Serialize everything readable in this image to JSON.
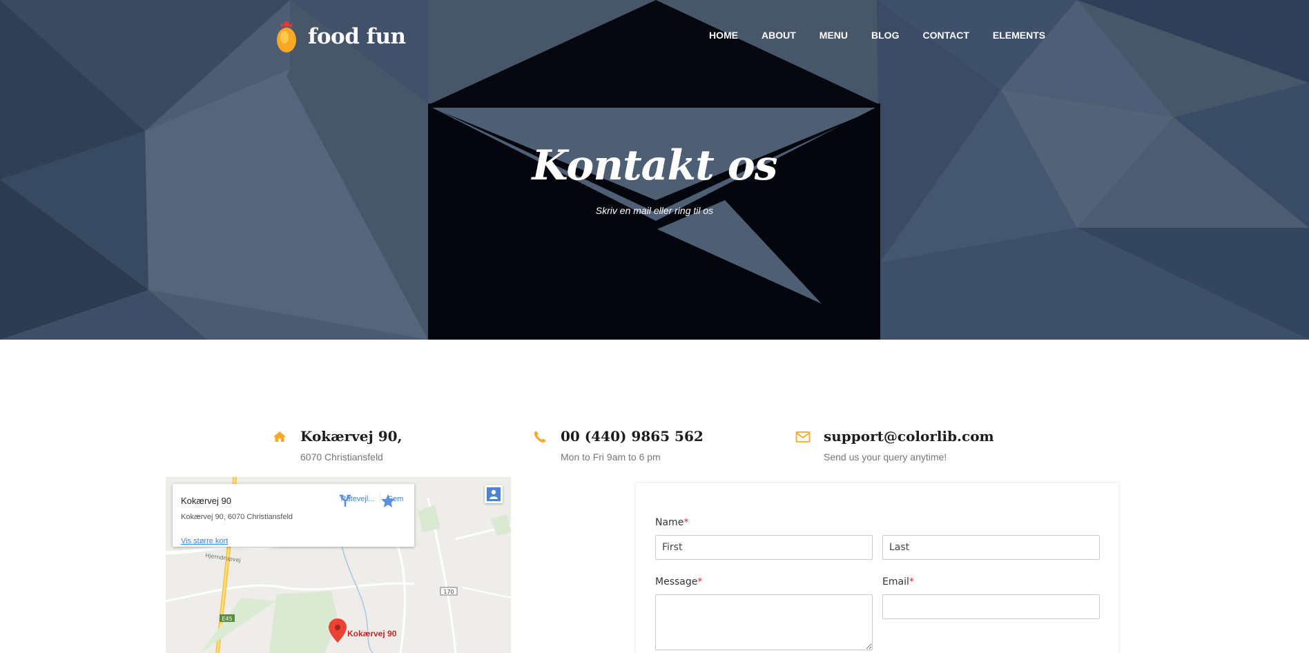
{
  "brand": {
    "name": "food fun"
  },
  "nav": {
    "items": [
      "HOME",
      "ABOUT",
      "MENU",
      "BLOG",
      "CONTACT",
      "ELEMENTS"
    ]
  },
  "hero": {
    "title": "Kontakt os",
    "subtitle": "Skriv en mail eller ring til os"
  },
  "info": {
    "address": {
      "icon": "home-icon",
      "title": "Kokærvej 90,",
      "sub": "6070 Christiansfeld"
    },
    "phone": {
      "icon": "phone-icon",
      "title": "00 (440) 9865 562",
      "sub": "Mon to Fri 9am to 6 pm"
    },
    "email": {
      "icon": "envelope-icon",
      "title": "support@colorlib.com",
      "sub": "Send us your query anytime!"
    }
  },
  "map": {
    "card_title": "Kokærvej 90",
    "card_address": "Kokærvej 90, 6070 Christiansfeld",
    "directions_label": "Rutevejl...",
    "save_label": "Gem",
    "larger_map_link": "Vis større kort",
    "pin_label": "Kokærvej 90",
    "road_label": "Hjerndrupvej",
    "road_badge_1": "E45",
    "road_badge_2": "170"
  },
  "form": {
    "name_label": "Name",
    "first_placeholder": "First",
    "last_placeholder": "Last",
    "message_label": "Message",
    "email_label": "Email",
    "required_mark": "*"
  },
  "colors": {
    "accent": "#f9a825",
    "hero_bg": "#46556b",
    "link": "#3a84df",
    "required": "#d32f2f"
  }
}
